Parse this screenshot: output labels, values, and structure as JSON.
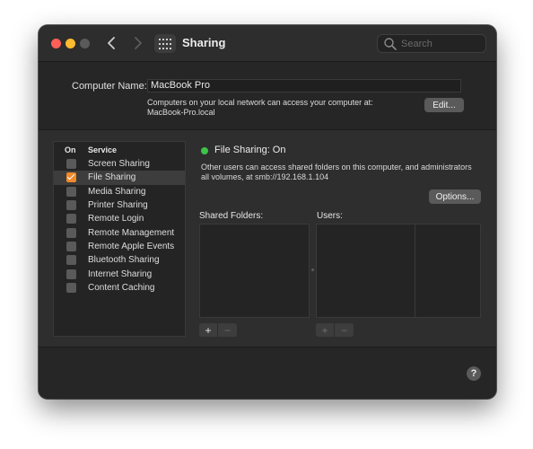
{
  "window": {
    "title": "Sharing",
    "search_placeholder": "Search"
  },
  "computer": {
    "name_label": "Computer Name:",
    "name_value": "MacBook Pro",
    "desc_line1": "Computers on your local network can access your computer at:",
    "desc_line2": "MacBook-Pro.local",
    "edit_label": "Edit..."
  },
  "services": {
    "header_on": "On",
    "header_service": "Service",
    "items": [
      {
        "label": "Screen Sharing",
        "checked": false
      },
      {
        "label": "File Sharing",
        "checked": true,
        "selected": true
      },
      {
        "label": "Media Sharing",
        "checked": false
      },
      {
        "label": "Printer Sharing",
        "checked": false
      },
      {
        "label": "Remote Login",
        "checked": false
      },
      {
        "label": "Remote Management",
        "checked": false
      },
      {
        "label": "Remote Apple Events",
        "checked": false
      },
      {
        "label": "Bluetooth Sharing",
        "checked": false
      },
      {
        "label": "Internet Sharing",
        "checked": false
      },
      {
        "label": "Content Caching",
        "checked": false
      }
    ]
  },
  "detail": {
    "status": "File Sharing: On",
    "status_color": "#3fc34a",
    "desc_line1": "Other users can access shared folders on this computer, and administrators",
    "desc_line2": "all volumes, at smb://192.168.1.104",
    "options_label": "Options...",
    "shared_folders_label": "Shared Folders:",
    "users_label": "Users:",
    "plus": "+",
    "minus": "−"
  },
  "help_label": "?",
  "colors": {
    "accent_checkbox": "#f0892a",
    "close": "#ff5f57",
    "minimize": "#febc2e"
  }
}
